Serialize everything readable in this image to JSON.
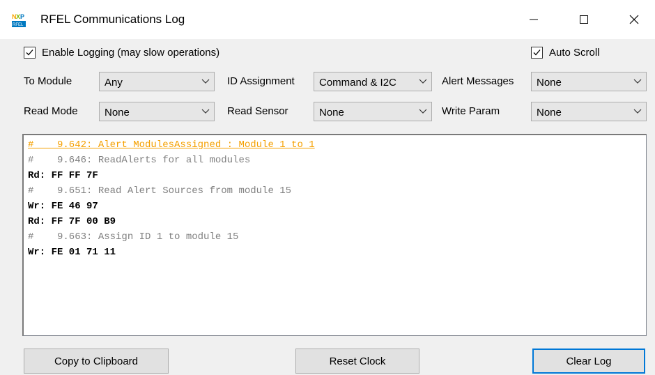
{
  "window": {
    "title": "RFEL Communications Log",
    "app_icon_text": "NXP RFEL"
  },
  "options": {
    "enable_logging_label": "Enable Logging (may slow operations)",
    "enable_logging_checked": true,
    "auto_scroll_label": "Auto Scroll",
    "auto_scroll_checked": true
  },
  "filters": {
    "to_module": {
      "label": "To Module",
      "value": "Any"
    },
    "id_assignment": {
      "label": "ID Assignment",
      "value": "Command & I2C"
    },
    "alert_messages": {
      "label": "Alert Messages",
      "value": "None"
    },
    "read_mode": {
      "label": "Read Mode",
      "value": "None"
    },
    "read_sensor": {
      "label": "Read Sensor",
      "value": "None"
    },
    "write_param": {
      "label": "Write Param",
      "value": "None"
    }
  },
  "log": {
    "lines": [
      {
        "type": "alert",
        "text": "#    9.642: Alert ModulesAssigned : Module 1 to 1"
      },
      {
        "type": "comment",
        "text": "#    9.646: ReadAlerts for all modules"
      },
      {
        "type": "data",
        "text": "Rd: FF FF 7F"
      },
      {
        "type": "comment",
        "text": "#    9.651: Read Alert Sources from module 15"
      },
      {
        "type": "data",
        "text": "Wr: FE 46 97"
      },
      {
        "type": "data",
        "text": "Rd: FF 7F 00 B9"
      },
      {
        "type": "comment",
        "text": "#    9.663: Assign ID 1 to module 15"
      },
      {
        "type": "data",
        "text": "Wr: FE 01 71 11"
      }
    ]
  },
  "buttons": {
    "copy": "Copy to Clipboard",
    "reset": "Reset Clock",
    "clear": "Clear Log"
  },
  "colors": {
    "alert": "#f5a000",
    "comment": "#808080",
    "default_button_border": "#0078d7"
  }
}
